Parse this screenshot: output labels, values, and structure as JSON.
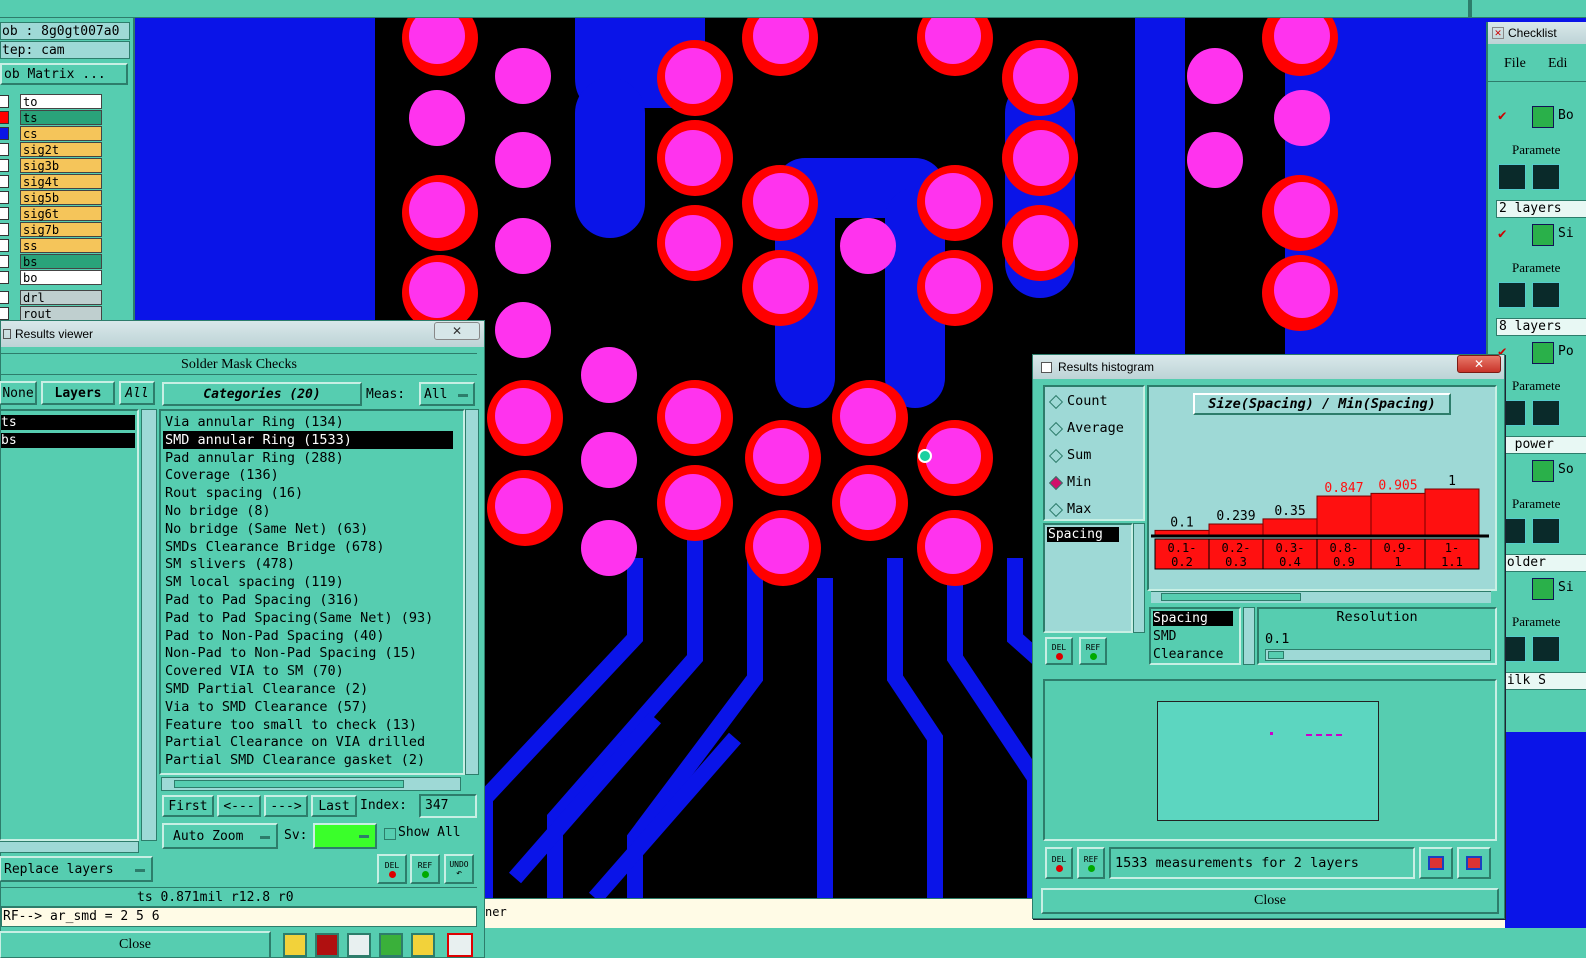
{
  "job_panel": {
    "job": "ob : 8g0gt007a0",
    "step": "tep: cam",
    "matrix_button": "ob Matrix ..."
  },
  "layers": [
    {
      "name": "to",
      "swatch": "#ffffff",
      "bg": "#ffffff"
    },
    {
      "name": "ts",
      "swatch": "#ff0000",
      "bg": "#2aa37a"
    },
    {
      "name": "cs",
      "swatch": "#0a14e8",
      "bg": "#f5c55a"
    },
    {
      "name": "sig2t",
      "swatch": "#ffffff",
      "bg": "#f5c55a"
    },
    {
      "name": "sig3b",
      "swatch": "#ffffff",
      "bg": "#f5c55a"
    },
    {
      "name": "sig4t",
      "swatch": "#ffffff",
      "bg": "#f5c55a"
    },
    {
      "name": "sig5b",
      "swatch": "#ffffff",
      "bg": "#f5c55a"
    },
    {
      "name": "sig6t",
      "swatch": "#ffffff",
      "bg": "#f5c55a"
    },
    {
      "name": "sig7b",
      "swatch": "#ffffff",
      "bg": "#f5c55a"
    },
    {
      "name": "ss",
      "swatch": "#ffffff",
      "bg": "#f5c55a"
    },
    {
      "name": "bs",
      "swatch": "#ffffff",
      "bg": "#2aa37a"
    },
    {
      "name": "bo",
      "swatch": "#ffffff",
      "bg": "#ffffff"
    },
    {
      "name": "drl",
      "swatch": "#ffffff",
      "bg": "#bfcfcf"
    },
    {
      "name": "rout",
      "swatch": "#ffffff",
      "bg": "#bfcfcf"
    }
  ],
  "results_viewer": {
    "window_title": "Results viewer",
    "close_x": "✕",
    "header": "Solder Mask Checks",
    "none_btn": "None",
    "layers_btn": "Layers",
    "all_btn": "All",
    "selected_layers": [
      "ts",
      "bs"
    ],
    "categories_btn": "Categories (20)",
    "meas_label": "Meas:",
    "meas_value": "All",
    "categories": [
      "Via annular Ring (134)",
      "SMD annular Ring (1533)",
      "Pad annular Ring (288)",
      "Coverage (136)",
      "Rout spacing (16)",
      "No bridge (8)",
      "No bridge (Same Net) (63)",
      "SMDs Clearance Bridge (678)",
      "SM slivers (478)",
      "SM local spacing (119)",
      "Pad to Pad Spacing (316)",
      "Pad to Pad Spacing(Same Net) (93)",
      "Pad to Non-Pad Spacing (40)",
      "Non-Pad to Non-Pad Spacing (15)",
      "Covered VIA to SM (70)",
      "SMD Partial Clearance (2)",
      "Via to SMD Clearance (57)",
      "Feature too small to check (13)",
      "Partial Clearance on VIA drilled",
      "Partial SMD Clearance gasket (2)"
    ],
    "first_btn": "First",
    "prev_btn": "<---",
    "next_btn": "--->",
    "last_btn": "Last",
    "index_label": "Index:",
    "index_value": "347",
    "auto_zoom": "Auto Zoom",
    "sv_label": "Sv:",
    "show_all": "Show All",
    "replace_layers": "Replace layers",
    "del": "DEL",
    "ref": "REF",
    "undo": "UNDO",
    "status": "ts 0.871mil  r12.8  r0",
    "command": "RF--> ar_smd = 2 5 6",
    "close_btn": "Close"
  },
  "histogram": {
    "window_title": "Results histogram",
    "close_x": "✕",
    "options": [
      "Count",
      "Average",
      "Sum",
      "Min",
      "Max"
    ],
    "selected_option": "Min",
    "title": "Size(Spacing) / Min(Spacing)",
    "list_item": "Spacing",
    "measures": [
      "Spacing",
      "SMD",
      "Clearance"
    ],
    "resolution_label": "Resolution",
    "resolution_value": "0.1",
    "status": "1533 measurements for 2 layers",
    "del": "DEL",
    "ref": "REF",
    "close_btn": "Close"
  },
  "chart_data": {
    "type": "bar",
    "title": "Size(Spacing) / Min(Spacing)",
    "categories": [
      "0.1-0.2",
      "0.2-0.3",
      "0.3-0.4",
      "0.8-0.9",
      "0.9-1",
      "1-1.1"
    ],
    "category_lines": [
      [
        "0.1-",
        "0.2"
      ],
      [
        "0.2-",
        "0.3"
      ],
      [
        "0.3-",
        "0.4"
      ],
      [
        "0.8-",
        "0.9"
      ],
      [
        "0.9-",
        "1"
      ],
      [
        "1-",
        "1.1"
      ]
    ],
    "values": [
      0.1,
      0.239,
      0.35,
      0.847,
      0.905,
      1
    ],
    "value_labels": [
      "0.1",
      "0.239",
      "0.35",
      "0.847",
      "0.905",
      "1"
    ],
    "ylim": [
      0,
      1
    ],
    "highlight_color": "#ff1010"
  },
  "checklist": {
    "title": "Checklist",
    "menu_file": "File",
    "menu_edit": "Edi",
    "items": [
      "Bo",
      "Si",
      "Po",
      "So",
      "Si"
    ],
    "param_label": "Paramete",
    "layer_texts": [
      "2 layers",
      "8 layers",
      "o power",
      "Solder",
      "Silk S"
    ]
  },
  "footer_fragment": "ner",
  "colors": {
    "pad": "#ff33ee",
    "mask": "#ff0000",
    "copper": "#0a14e8",
    "substrate": "#000000",
    "panel": "#56cdb0"
  }
}
